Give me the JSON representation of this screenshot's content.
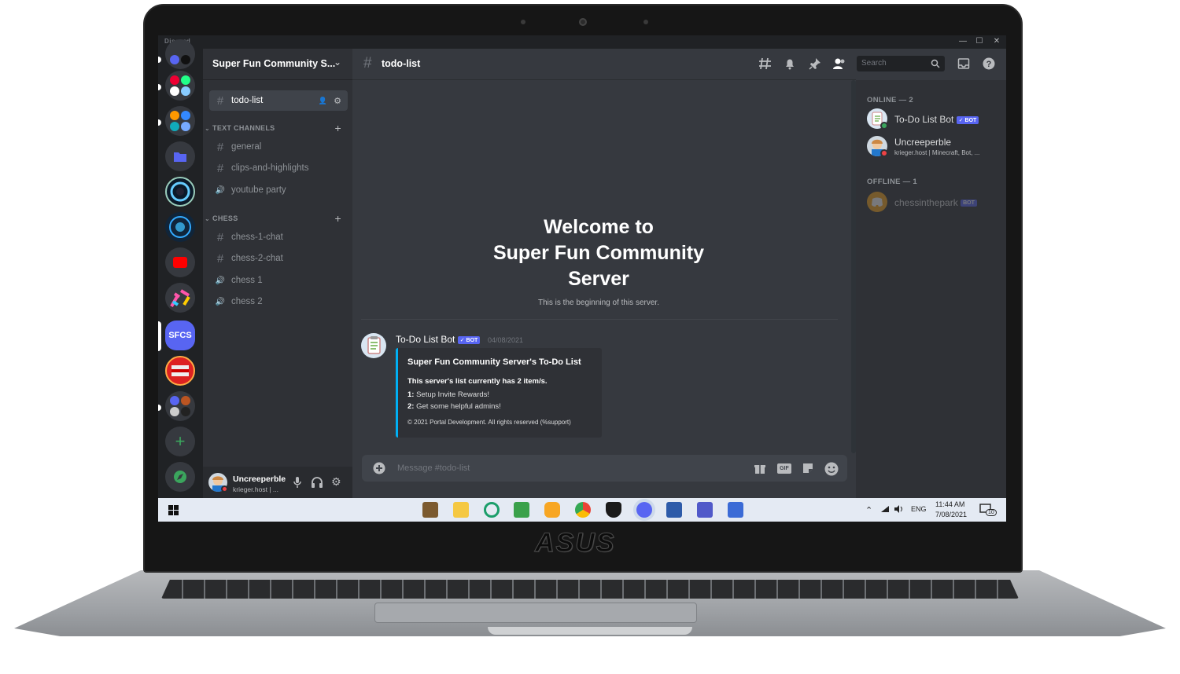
{
  "window": {
    "app_name": "Discord",
    "min_glyph": "—",
    "max_glyph": "☐",
    "close_glyph": "✕"
  },
  "brand": {
    "laptop_logo": "ASUS"
  },
  "server_rail": {
    "active_server_abbrev": "SFCS",
    "add_glyph": "+",
    "explore_glyph": "🧭"
  },
  "server_header": {
    "name": "Super Fun Community S...",
    "chevron": "⌄"
  },
  "channels": {
    "pinned": {
      "label": "todo-list",
      "add_icon": "👤",
      "settings_icon": "⚙"
    },
    "categories": [
      {
        "label": "TEXT CHANNELS",
        "channels": [
          {
            "label": "general",
            "type": "text"
          },
          {
            "label": "clips-and-highlights",
            "type": "text"
          },
          {
            "label": "youtube party",
            "type": "voice"
          }
        ]
      },
      {
        "label": "CHESS",
        "channels": [
          {
            "label": "chess-1-chat",
            "type": "text"
          },
          {
            "label": "chess-2-chat",
            "type": "text"
          },
          {
            "label": "chess 1",
            "type": "voice"
          },
          {
            "label": "chess 2",
            "type": "voice"
          }
        ]
      }
    ],
    "hash_glyph": "#",
    "voice_glyph": "🔊",
    "add_glyph": "+",
    "collapse_glyph": "⌄"
  },
  "user_panel": {
    "username": "Uncreeperble",
    "status": "krieger.host | ..."
  },
  "chat_header": {
    "channel": "todo-list",
    "search_placeholder": "Search"
  },
  "welcome": {
    "line1": "Welcome to",
    "line2": "Super Fun Community",
    "line3": "Server",
    "subtitle": "This is the beginning of this server."
  },
  "message": {
    "author": "To-Do List Bot",
    "badge": "✓ BOT",
    "timestamp": "04/08/2021",
    "embed": {
      "title": "Super Fun Community Server's To-Do List",
      "summary": "This server's list currently has 2 item/s.",
      "items": [
        {
          "num": "1:",
          "text": "Setup Invite Rewards!"
        },
        {
          "num": "2:",
          "text": "Get some helpful admins!"
        }
      ],
      "footer": "© 2021 Portal Development. All rights reserved (%support)"
    }
  },
  "composer": {
    "placeholder": "Message #todo-list",
    "gif_label": "GIF"
  },
  "members": {
    "online_header": "ONLINE — 2",
    "offline_header": "OFFLINE — 1",
    "online": [
      {
        "name": "To-Do List Bot",
        "badge": "✓ BOT",
        "sub": ""
      },
      {
        "name": "Uncreeperble",
        "badge": "",
        "sub": "krieger.host | Minecraft, Bot, ..."
      }
    ],
    "offline": [
      {
        "name": "chessintheparkbot",
        "display": "chessinthepark",
        "badge": "BOT"
      }
    ]
  },
  "taskbar": {
    "lang": "ENG",
    "time": "11:44 AM",
    "date": "7/08/2021",
    "notif_count": "10"
  },
  "colors": {
    "bg_chat": "#36393f",
    "bg_sidebar": "#2f3136",
    "bg_rail": "#202225",
    "blurple": "#5865f2",
    "embed_accent": "#00b0f4",
    "online": "#3ba55d",
    "dnd": "#ed4245"
  }
}
